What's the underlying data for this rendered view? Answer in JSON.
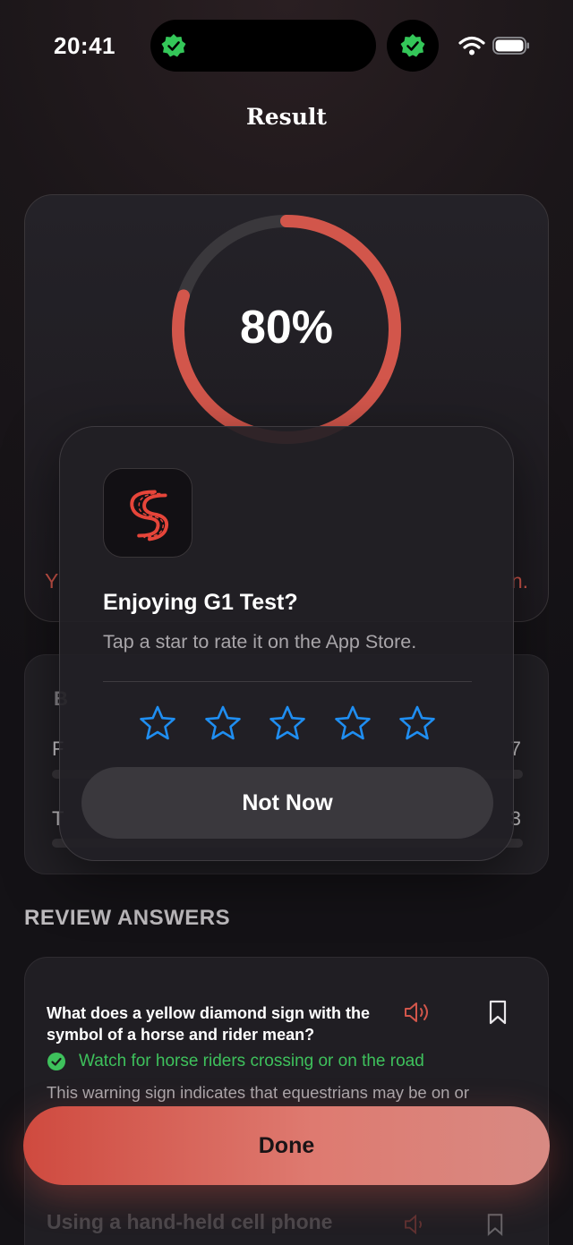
{
  "status_bar": {
    "time": "20:41"
  },
  "header": {
    "title": "Result"
  },
  "score": {
    "percent_label": "80%",
    "percent": 80,
    "ring_color": "#d2564b"
  },
  "result_message": {
    "left_fragment": "Y",
    "right_fragment": "n."
  },
  "breakdown": {
    "heading_fragment": "B",
    "rows": [
      {
        "label_fragment": "F",
        "value_fragment": "7",
        "fill": 0.0
      },
      {
        "label_fragment": "T",
        "value_fragment": "3",
        "fill": 0.0
      }
    ]
  },
  "review": {
    "heading": "REVIEW ANSWERS",
    "questions": [
      {
        "question": "What does a yellow diamond sign with the symbol of a horse and rider mean?",
        "answer": "Watch for horse riders crossing or on the road",
        "explanation": "This warning sign indicates that equestrians may be on or"
      },
      {
        "question": "Using a hand-held cell phone"
      }
    ]
  },
  "done_button": {
    "label": "Done"
  },
  "rating_dialog": {
    "title": "Enjoying G1 Test?",
    "subtitle": "Tap a star to rate it on the App Store.",
    "star_count": 5,
    "star_color": "#1f8ef1",
    "dismiss_label": "Not Now"
  },
  "colors": {
    "accent": "#d2564b",
    "correct": "#3ec15c",
    "verified": "#34c759"
  },
  "icons": [
    "verified-icon",
    "wifi-icon",
    "battery-icon",
    "speaker-icon",
    "bookmark-icon",
    "check-circle-icon",
    "star-icon",
    "app-road-icon"
  ]
}
